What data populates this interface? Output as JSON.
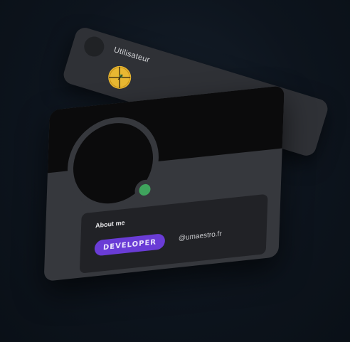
{
  "back_card": {
    "username": "Utilisateur",
    "badge_icon": "gold-compass-badge-icon"
  },
  "profile_card": {
    "about_title": "About me",
    "role_badge": "DEVELOPER",
    "handle": "@umaestro.fr",
    "status": "online",
    "colors": {
      "card": "#36383d",
      "banner": "#0b0b0c",
      "panel": "#212226",
      "status_online": "#3fa45d",
      "role_accent": "#6a3cd6",
      "badge_gold": "#e8b832"
    }
  }
}
